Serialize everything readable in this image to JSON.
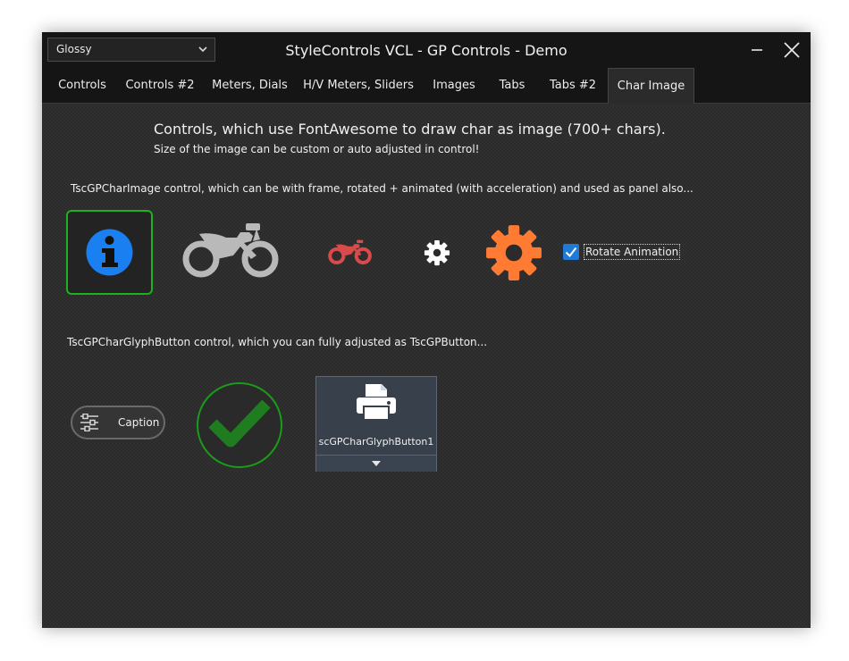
{
  "window": {
    "title": "StyleControls VCL - GP Controls - Demo",
    "style_select": {
      "value": "Glossy"
    }
  },
  "tabs": [
    {
      "label": "Controls",
      "active": false
    },
    {
      "label": "Controls #2",
      "active": false
    },
    {
      "label": "Meters, Dials",
      "active": false
    },
    {
      "label": "H/V Meters, Sliders",
      "active": false
    },
    {
      "label": "Images",
      "active": false
    },
    {
      "label": "Tabs",
      "active": false
    },
    {
      "label": "Tabs #2",
      "active": false
    },
    {
      "label": "Char Image",
      "active": true
    }
  ],
  "content": {
    "heading": "Controls, which use FontAwesome to draw char as image (700+ chars).",
    "subheading": "Size of the image can be custom or auto adjusted in control!",
    "char_image_desc": "TscGPCharImage control, which can be with frame, rotated + animated (with acceleration) and used as panel also...",
    "rotate_animation": {
      "label": "Rotate Animation",
      "checked": true
    },
    "glyph_button_desc": "TscGPCharGlyphButton control, which you can fully adjusted as TscGPButton...",
    "caption_button": {
      "label": "Caption"
    },
    "glyph_button": {
      "label": "scGPCharGlyphButton1"
    }
  },
  "icons": {
    "info": "info-circle-icon",
    "motorcycle_large": "motorcycle-icon",
    "motorcycle_small": "motorcycle-icon",
    "gear_small": "gear-icon",
    "gear_large": "gear-icon",
    "sliders": "sliders-icon",
    "check": "check-icon",
    "print": "print-icon",
    "dropdown": "caret-down-icon"
  },
  "colors": {
    "info_blue": "#1a7ff0",
    "frame_green": "#1db21d",
    "motorcycle_gray": "#b9b9b9",
    "motorcycle_red": "#d94a4a",
    "gear_orange": "#ff7a32",
    "check_green": "#1f7d1f",
    "checkbox_blue": "#1e7ad6"
  }
}
